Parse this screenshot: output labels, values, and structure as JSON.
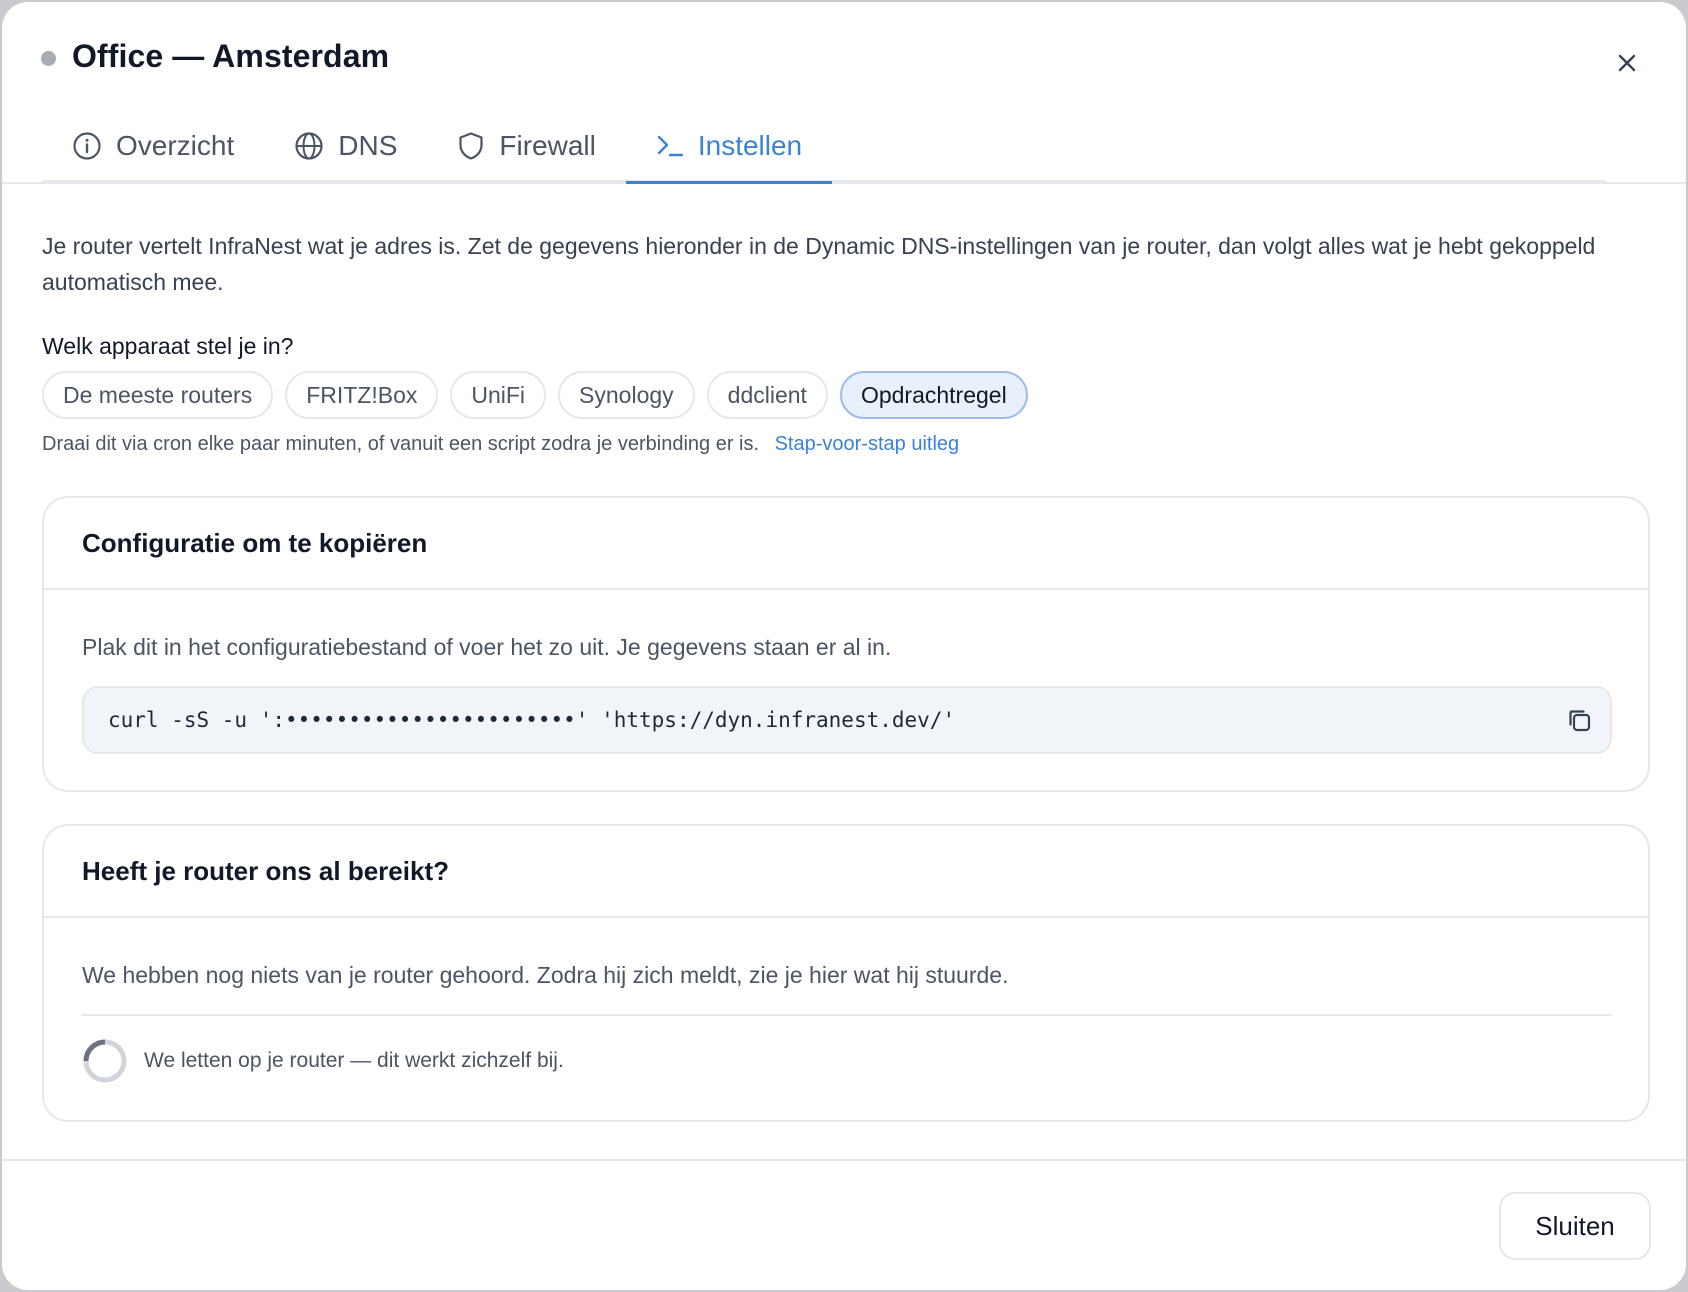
{
  "dialog": {
    "title": "Office — Amsterdam",
    "close_icon": "close-icon"
  },
  "tabs": [
    {
      "label": "Overzicht",
      "icon": "info-icon",
      "active": false
    },
    {
      "label": "DNS",
      "icon": "globe-icon",
      "active": false
    },
    {
      "label": "Firewall",
      "icon": "shield-icon",
      "active": false
    },
    {
      "label": "Instellen",
      "icon": "terminal-icon",
      "active": true
    }
  ],
  "intro": "Je router vertelt InfraNest wat je adres is. Zet de gegevens hieronder in de Dynamic DNS-instellingen van je router, dan volgt alles wat je hebt gekoppeld automatisch mee.",
  "device_picker": {
    "label": "Welk apparaat stel je in?",
    "options": [
      "De meeste routers",
      "FRITZ!Box",
      "UniFi",
      "Synology",
      "ddclient",
      "Opdrachtregel"
    ],
    "selected": "Opdrachtregel"
  },
  "hint": {
    "text": "Draai dit via cron elke paar minuten, of vanuit een script zodra je verbinding er is.",
    "link": "Stap-voor-stap uitleg"
  },
  "config_card": {
    "title": "Configuratie om te kopiëren",
    "description": "Plak dit in het configuratiebestand of voer het zo uit. Je gegevens staan er al in.",
    "code": "curl -sS -u ':•••••••••••••••••••••••' 'https://dyn.infranest.dev/'",
    "copy_icon": "copy-icon"
  },
  "status_card": {
    "title": "Heeft je router ons al bereikt?",
    "description": "We hebben nog niets van je router gehoord. Zodra hij zich meldt, zie je hier wat hij stuurde.",
    "status": "We letten op je router — dit werkt zichzelf bij."
  },
  "footer": {
    "close_label": "Sluiten"
  },
  "colors": {
    "accent": "#3b82d6",
    "status_dot": "#a9adb3"
  }
}
